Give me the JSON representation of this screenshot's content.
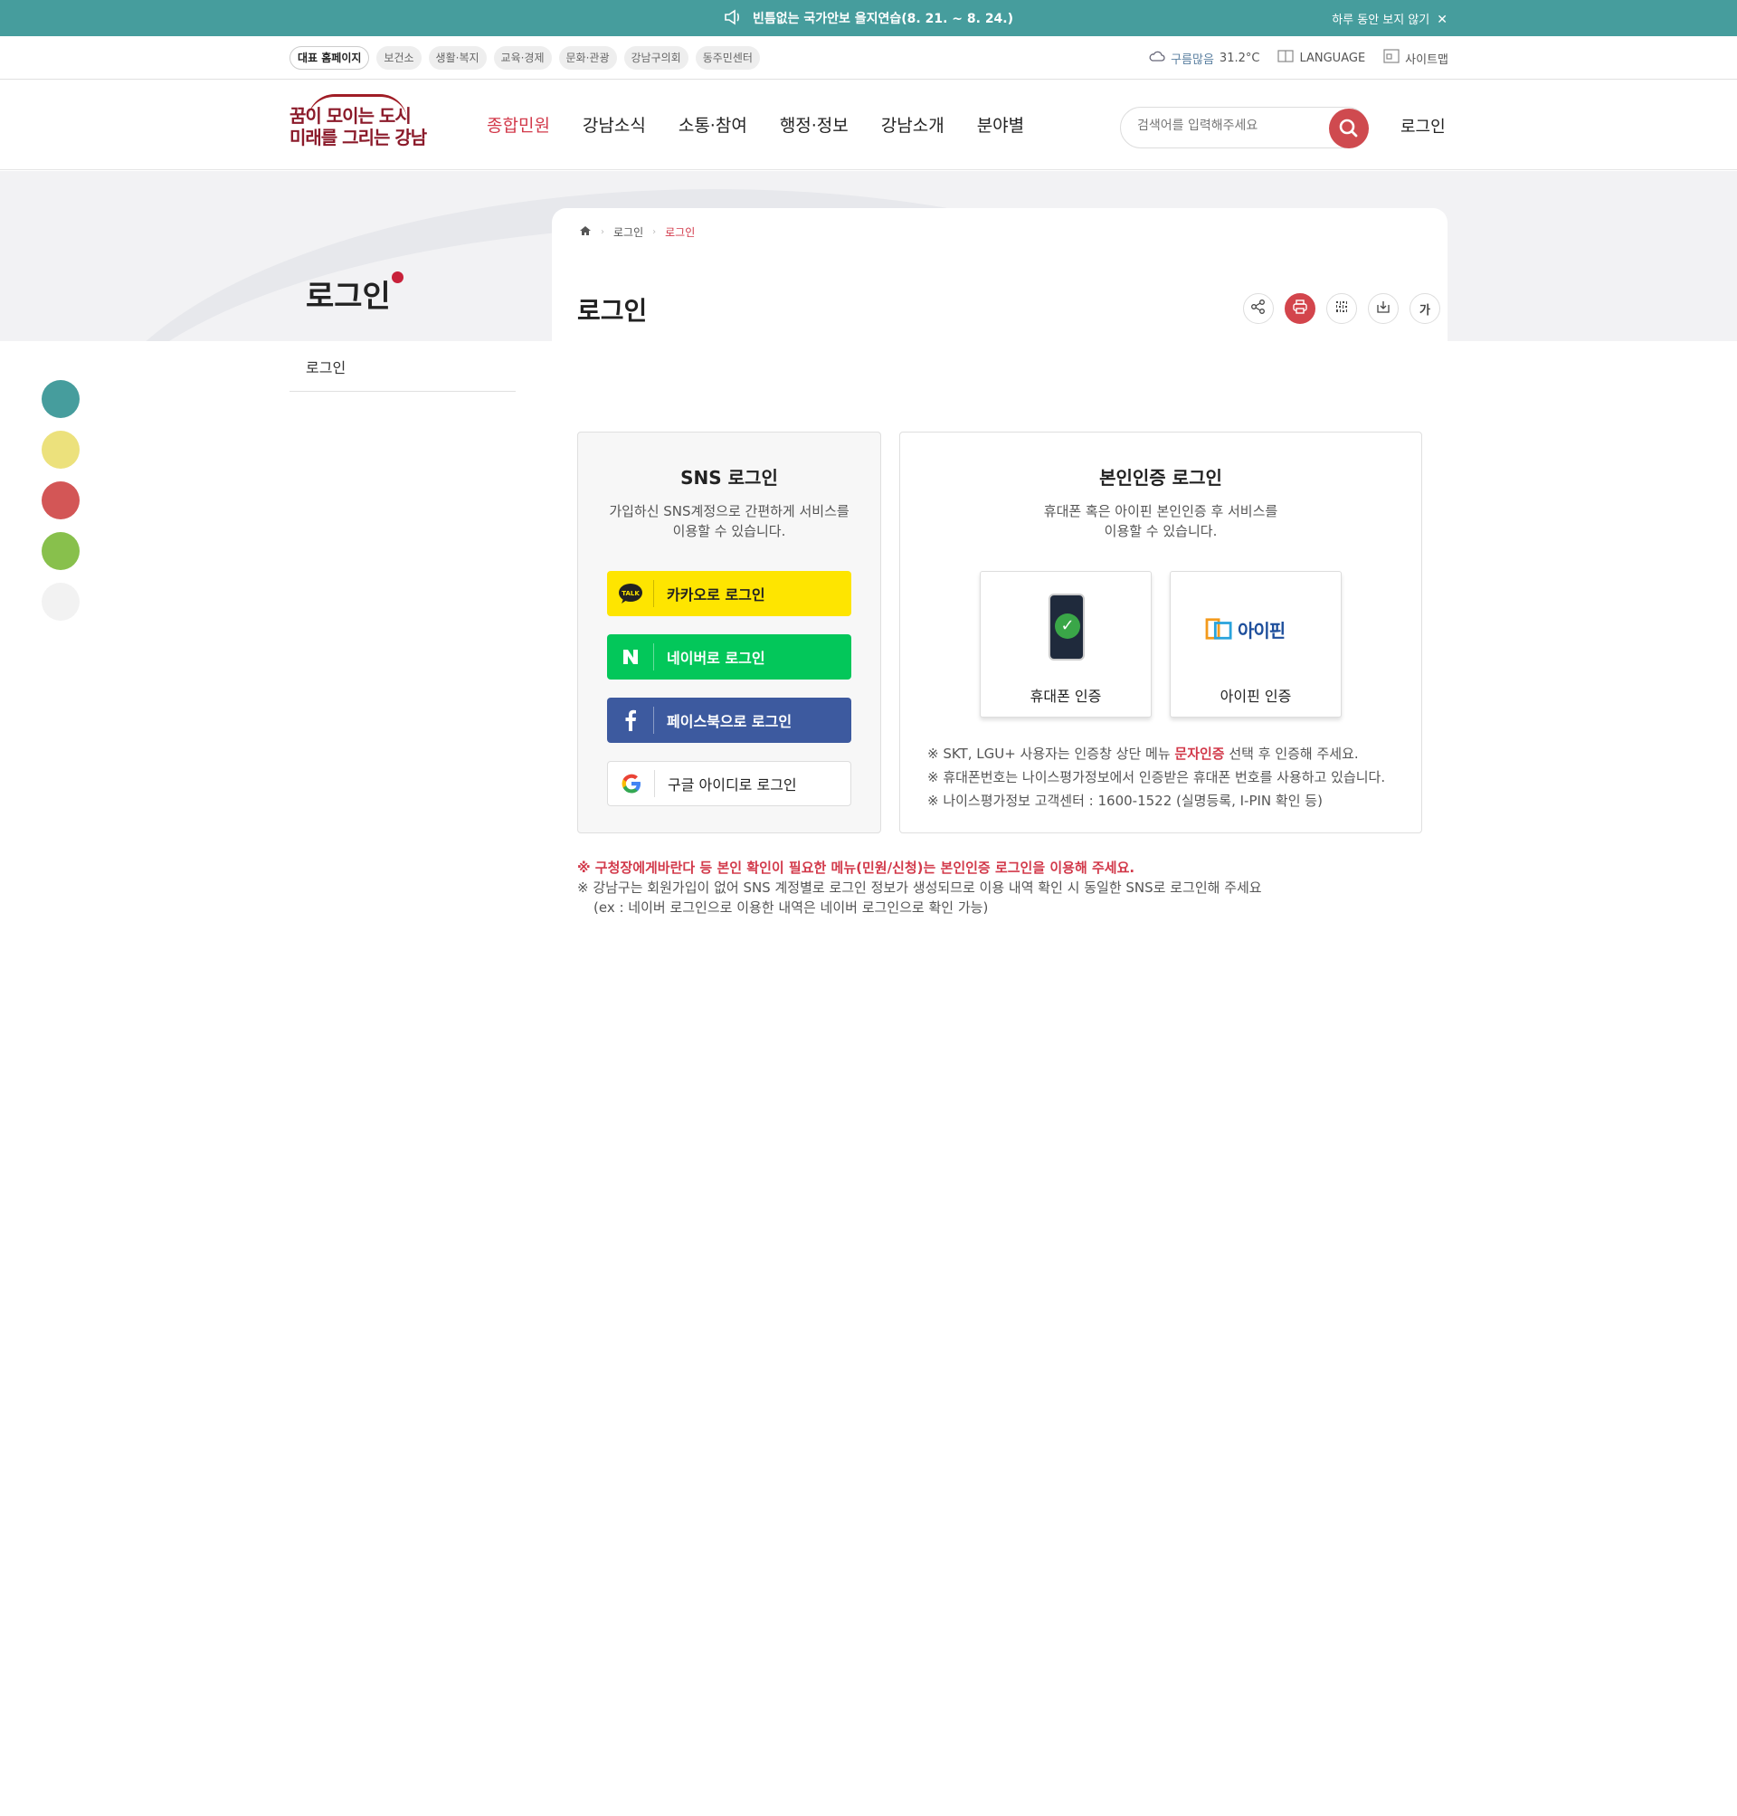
{
  "notice": {
    "message": "빈틈없는 국가안보 을지연습(8. 21. ~ 8. 24.)",
    "dismiss_label": "하루 동안 보지 않기"
  },
  "site_links": [
    {
      "label": "대표 홈페이지",
      "active": true
    },
    {
      "label": "보건소"
    },
    {
      "label": "생활·복지"
    },
    {
      "label": "교육·경제"
    },
    {
      "label": "문화·관광"
    },
    {
      "label": "강남구의회"
    },
    {
      "label": "동주민센터"
    }
  ],
  "utility": {
    "weather_label": "구름많음",
    "temperature": "31.2°C",
    "language_label": "LANGUAGE",
    "sitemap_label": "사이트맵"
  },
  "logo": {
    "line1": "꿈이 모이는 도시",
    "line2": "미래를 그리는 강남"
  },
  "gnb": [
    {
      "label": "종합민원",
      "active": true
    },
    {
      "label": "강남소식"
    },
    {
      "label": "소통·참여"
    },
    {
      "label": "행정·정보"
    },
    {
      "label": "강남소개"
    },
    {
      "label": "분야별"
    }
  ],
  "search": {
    "placeholder": "검색어를 입력해주세요"
  },
  "header_login": "로그인",
  "side_title": "로그인",
  "lnb_item": "로그인",
  "breadcrumb": [
    "로그인",
    "로그인"
  ],
  "page_title": "로그인",
  "tool_font_label": "가",
  "color_themes": [
    "#469d9d",
    "#ece17c",
    "#d35656",
    "#88c04c",
    "#f2f2f2"
  ],
  "sns": {
    "title": "SNS 로그인",
    "desc": "가입하신 SNS계정으로 간편하게 서비스를\n이용할 수 있습니다.",
    "kakao": "카카오로 로그인",
    "kakao_icon_text": "TALK",
    "naver": "네이버로 로그인",
    "facebook": "페이스북으로 로그인",
    "google": "구글 아이디로 로그인"
  },
  "cert": {
    "title": "본인인증 로그인",
    "desc": "휴대폰 혹은 아이핀 본인인증 후 서비스를\n이용할 수 있습니다.",
    "phone_label": "휴대폰 인증",
    "ipin_label": "아이핀 인증",
    "ipin_logo_text": "아이핀",
    "note1_pre": "※ SKT, LGU+ 사용자는 인증창 상단 메뉴 ",
    "note1_hl": "문자인증",
    "note1_post": " 선택 후 인증해 주세요.",
    "note2": "※ 휴대폰번호는 나이스평가정보에서 인증받은 휴대폰 번호를 사용하고 있습니다.",
    "note3": "※ 나이스평가정보 고객센터 : 1600-1522 (실명등록, I-PIN 확인 등)"
  },
  "bottom_notes": {
    "red": "※ 구청장에게바란다 등 본인 확인이 필요한 메뉴(민원/신청)는 본인인증 로그인을 이용해 주세요.",
    "line1": "※ 강남구는 회원가입이 없어 SNS 계정별로 로그인 정보가 생성되므로 이용 내역 확인 시 동일한 SNS로 로그인해 주세요",
    "line2": "(ex : 네이버 로그인으로 이용한 내역은 네이버 로그인으로 확인 가능)"
  }
}
